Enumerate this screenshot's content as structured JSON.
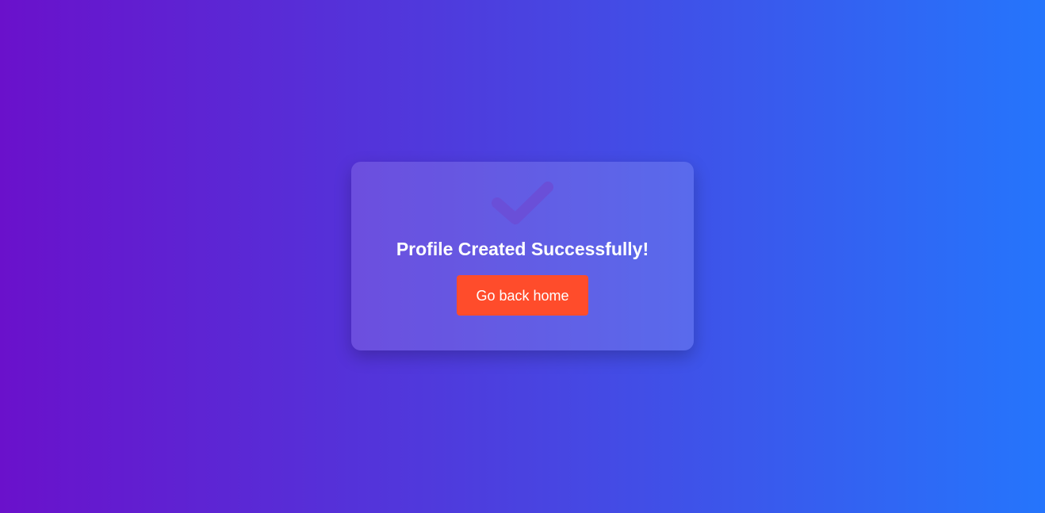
{
  "success_card": {
    "icon": "checkmark-icon",
    "title": "Profile Created Successfully!",
    "button_label": "Go back home"
  },
  "colors": {
    "gradient_start": "#6a11cb",
    "gradient_end": "#2575fc",
    "button": "#ff4c2b",
    "checkmark": "#6a4fd8",
    "text": "#ffffff"
  }
}
